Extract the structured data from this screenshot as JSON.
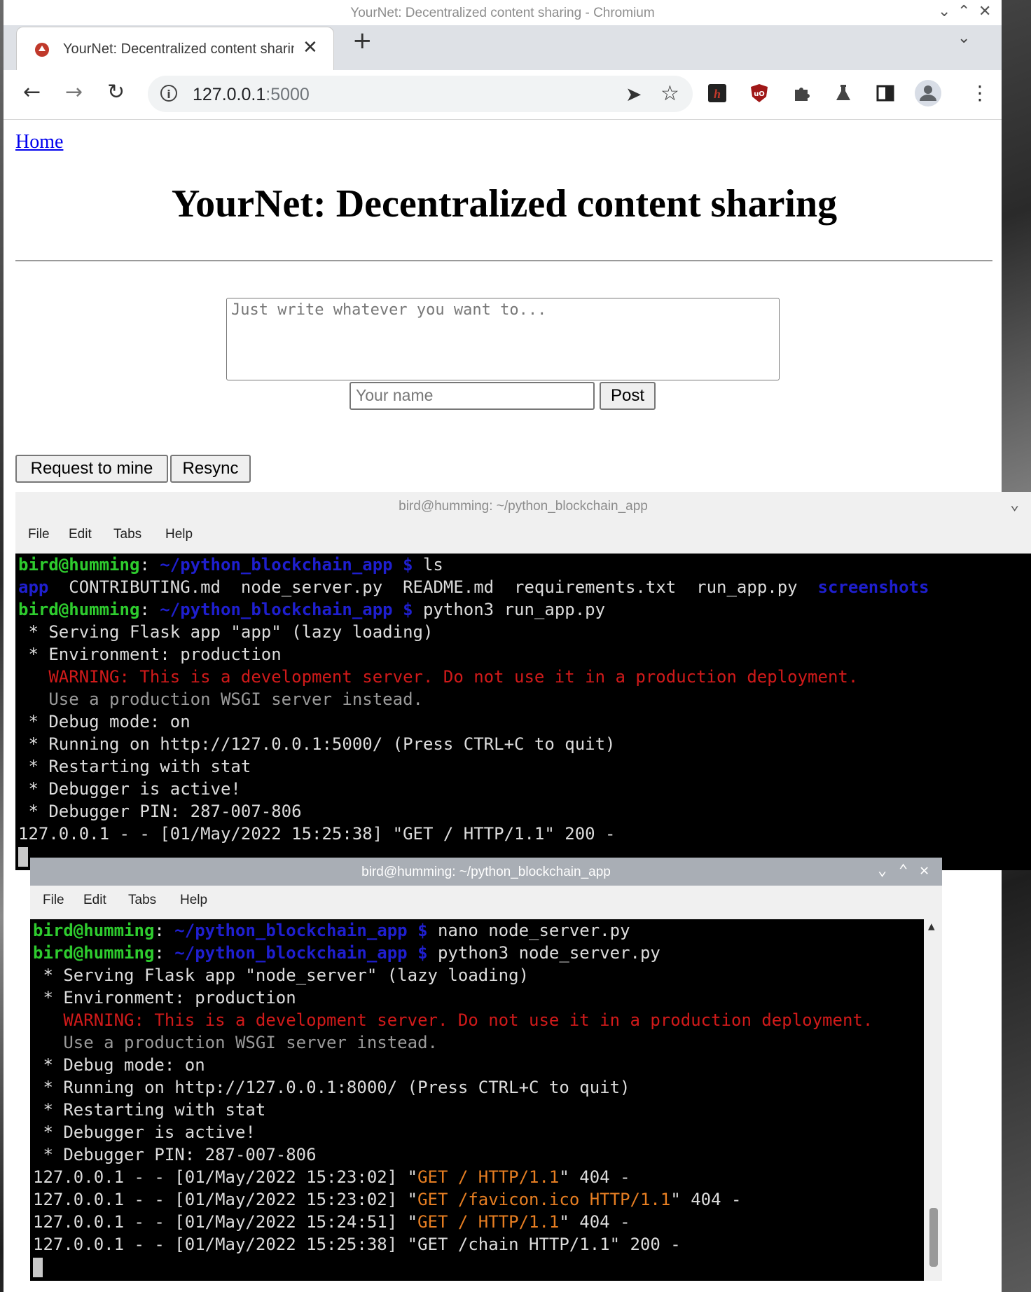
{
  "browser": {
    "window_title": "YourNet: Decentralized content sharing - Chromium",
    "tab_title": "YourNet: Decentralized content sharing",
    "url_host": "127.0.0.1",
    "url_port": ":5000",
    "back_icon": "←",
    "forward_icon": "→",
    "reload_icon": "↻",
    "new_tab_icon": "+",
    "close_tab_icon": "✕",
    "tab_menu_icon": "⌄"
  },
  "page": {
    "home_link": "Home",
    "title": "YourNet: Decentralized content sharing",
    "post_placeholder": "Just write whatever you want to...",
    "name_placeholder": "Your name",
    "post_button": "Post",
    "mine_button": "Request to mine",
    "resync_button": "Resync"
  },
  "terminal1": {
    "title": "bird@humming: ~/python_blockchain_app",
    "menu": [
      "File",
      "Edit",
      "Tabs",
      "Help"
    ],
    "prompt_user": "bird@humming",
    "prompt_path": "~/python_blockchain_app $",
    "cmd1": "ls",
    "ls_app": "app",
    "ls_files": "CONTRIBUTING.md  node_server.py  README.md  requirements.txt  run_app.py",
    "ls_dir": "screenshots",
    "cmd2": "python3 run_app.py",
    "out": [
      " * Serving Flask app \"app\" (lazy loading)",
      " * Environment: production",
      "   WARNING: This is a development server. Do not use it in a production deployment.",
      "   Use a production WSGI server instead.",
      " * Debug mode: on",
      " * Running on http://127.0.0.1:5000/ (Press CTRL+C to quit)",
      " * Restarting with stat",
      " * Debugger is active!",
      " * Debugger PIN: 287-007-806",
      "127.0.0.1 - - [01/May/2022 15:25:38] \"GET / HTTP/1.1\" 200 -"
    ]
  },
  "terminal2": {
    "title": "bird@humming: ~/python_blockchain_app",
    "menu": [
      "File",
      "Edit",
      "Tabs",
      "Help"
    ],
    "prompt_user": "bird@humming",
    "prompt_path": "~/python_blockchain_app $",
    "cmd1": "nano node_server.py",
    "cmd2": "python3 node_server.py",
    "out": [
      " * Serving Flask app \"node_server\" (lazy loading)",
      " * Environment: production",
      "   WARNING: This is a development server. Do not use it in a production deployment.",
      "   Use a production WSGI server instead.",
      " * Debug mode: on",
      " * Running on http://127.0.0.1:8000/ (Press CTRL+C to quit)",
      " * Restarting with stat",
      " * Debugger is active!",
      " * Debugger PIN: 287-007-806"
    ],
    "log_prefix_1": "127.0.0.1 - - [01/May/2022 15:23:02] \"",
    "log_req_1": "GET / HTTP/1.1",
    "log_suffix_1": "\" 404 -",
    "log_prefix_2": "127.0.0.1 - - [01/May/2022 15:23:02] \"",
    "log_req_2": "GET /favicon.ico HTTP/1.1",
    "log_suffix_2": "\" 404 -",
    "log_prefix_3": "127.0.0.1 - - [01/May/2022 15:24:51] \"",
    "log_req_3": "GET / HTTP/1.1",
    "log_suffix_3": "\" 404 -",
    "log_4": "127.0.0.1 - - [01/May/2022 15:25:38] \"GET /chain HTTP/1.1\" 200 -"
  }
}
